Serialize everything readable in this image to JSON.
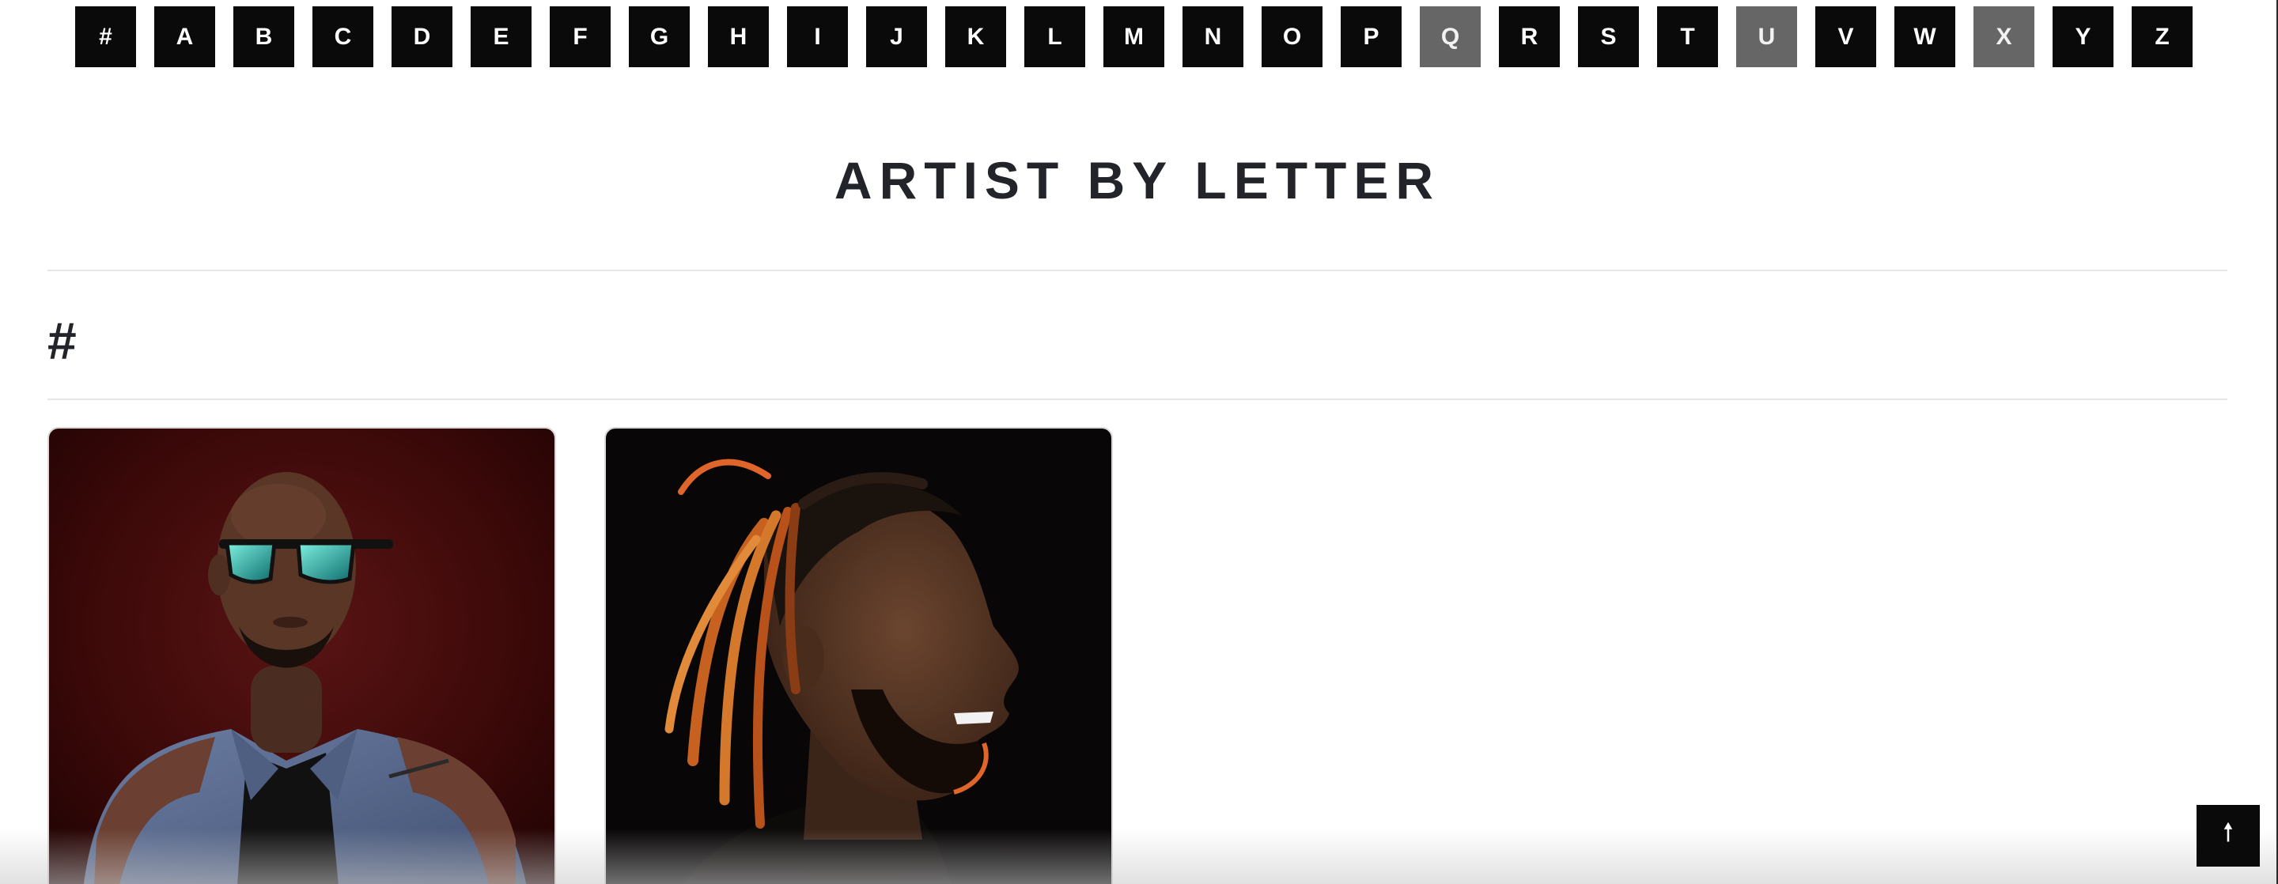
{
  "letter_nav": {
    "letters": [
      {
        "label": "#",
        "enabled": true
      },
      {
        "label": "A",
        "enabled": true
      },
      {
        "label": "B",
        "enabled": true
      },
      {
        "label": "C",
        "enabled": true
      },
      {
        "label": "D",
        "enabled": true
      },
      {
        "label": "E",
        "enabled": true
      },
      {
        "label": "F",
        "enabled": true
      },
      {
        "label": "G",
        "enabled": true
      },
      {
        "label": "H",
        "enabled": true
      },
      {
        "label": "I",
        "enabled": true
      },
      {
        "label": "J",
        "enabled": true
      },
      {
        "label": "K",
        "enabled": true
      },
      {
        "label": "L",
        "enabled": true
      },
      {
        "label": "M",
        "enabled": true
      },
      {
        "label": "N",
        "enabled": true
      },
      {
        "label": "O",
        "enabled": true
      },
      {
        "label": "P",
        "enabled": true
      },
      {
        "label": "Q",
        "enabled": false
      },
      {
        "label": "R",
        "enabled": true
      },
      {
        "label": "S",
        "enabled": true
      },
      {
        "label": "T",
        "enabled": true
      },
      {
        "label": "U",
        "enabled": false
      },
      {
        "label": "V",
        "enabled": true
      },
      {
        "label": "W",
        "enabled": true
      },
      {
        "label": "X",
        "enabled": false
      },
      {
        "label": "Y",
        "enabled": true
      },
      {
        "label": "Z",
        "enabled": true
      }
    ]
  },
  "page": {
    "title": "ARTIST BY LETTER"
  },
  "section": {
    "heading": "#"
  },
  "artists": [
    {
      "image": "portrait-man-sunglasses-denim-jacket"
    },
    {
      "image": "profile-portrait-man-dreadlocks"
    }
  ],
  "back_to_top": {
    "icon": "arrow-up-icon",
    "glyph": "🠕"
  },
  "colors": {
    "button_bg": "#0a0a0a",
    "button_disabled_bg": "#666666",
    "title_color": "#22242a",
    "divider": "#e6e6e6"
  }
}
